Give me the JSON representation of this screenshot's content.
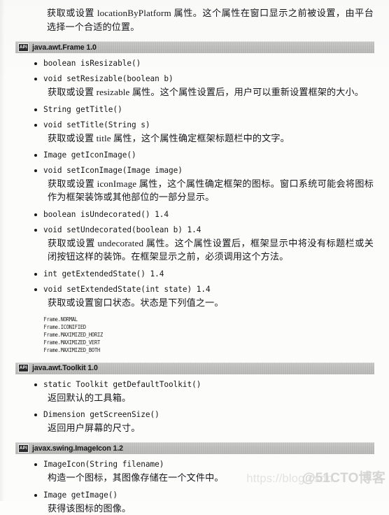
{
  "page": {
    "intro_paragraph": "获取或设置 locationByPlatform 属性。这个属性在窗口显示之前被设置，由平台选择一个合适的位置。",
    "watermark_url": "https://blog.csdn",
    "watermark_tag": "@51CTO博客"
  },
  "api_badge_label": "API",
  "sections": [
    {
      "title": "java.awt.Frame 1.0",
      "methods": [
        {
          "signature": "boolean isResizable()",
          "description": ""
        },
        {
          "signature": "void setResizable(boolean b)",
          "description": "获取或设置 resizable 属性。这个属性设置后，用户可以重新设置框架的大小。"
        },
        {
          "signature": "String getTitle()",
          "description": ""
        },
        {
          "signature": "void setTitle(String s)",
          "description": "获取或设置 title 属性，这个属性确定框架标题栏中的文字。"
        },
        {
          "signature": "Image getIconImage()",
          "description": ""
        },
        {
          "signature": "void setIconImage(Image image)",
          "description": "获取或设置 iconImage 属性，这个属性确定框架的图标。窗口系统可能会将图标作为框架装饰或其他部位的一部分显示。"
        },
        {
          "signature": "boolean isUndecorated() 1.4",
          "description": ""
        },
        {
          "signature": "void setUndecorated(boolean b) 1.4",
          "description": "获取或设置 undecorated 属性。这个属性设置后，框架显示中将没有标题栏或关闭按钮这样的装饰。在框架显示之前，必须调用这个方法。"
        },
        {
          "signature": "int getExtendedState() 1.4",
          "description": ""
        },
        {
          "signature": "void setExtendedState(int state) 1.4",
          "description": "获取或设置窗口状态。状态是下列值之一。"
        }
      ],
      "constants": [
        "Frame.NORMAL",
        "Frame.ICONIFIED",
        "Frame.MAXIMIZED_HORIZ",
        "Frame.MAXIMIZED_VERT",
        "Frame.MAXIMIZED_BOTH"
      ]
    },
    {
      "title": "java.awt.Toolkit 1.0",
      "methods": [
        {
          "signature": "static Toolkit getDefaultToolkit()",
          "description": "返回默认的工具箱。"
        },
        {
          "signature": "Dimension getScreenSize()",
          "description": "返回用户屏幕的尺寸。"
        }
      ],
      "constants": []
    },
    {
      "title": "javax.swing.ImageIcon 1.2",
      "methods": [
        {
          "signature": "ImageIcon(String filename)",
          "description": "构造一个图标，其图像存储在一个文件中。"
        },
        {
          "signature": "Image getImage()",
          "description": "获得该图标的图像。"
        }
      ],
      "constants": []
    }
  ]
}
